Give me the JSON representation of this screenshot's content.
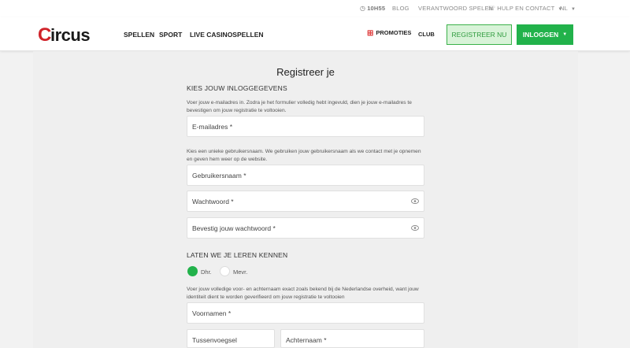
{
  "utility": {
    "time": "10H55",
    "blog": "BLOG",
    "responsible": "VERANTWOORD SPELEN",
    "help": "HULP EN CONTACT",
    "language": "NL"
  },
  "header": {
    "logo_text": "Circus",
    "nav": [
      "SPELLEN",
      "SPORT",
      "LIVE CASINOSPELLEN"
    ],
    "promotions": "PROMOTIES",
    "club": "CLUB",
    "register": "REGISTREER NU",
    "login": "INLOGGEN"
  },
  "form": {
    "title": "Registreer je",
    "section_login": "KIES JOUW INLOGGEGEVENS",
    "email_help_1": "Voer jouw e-mailadres in. Zodra je het formulier volledig hebt ingevuld, dien je jouw e-mailadres te",
    "email_help_2": "bevestigen om jouw registratie te voltooien.",
    "email_placeholder": "E-mailadres *",
    "username_help_1": "Kies een unieke gebruikersnaam. We gebruiken jouw gebruikersnaam als we contact met je opnemen",
    "username_help_2": "en geven hem weer op de website.",
    "username_placeholder": "Gebruikersnaam *",
    "password_placeholder": "Wachtwoord *",
    "confirm_placeholder": "Bevestig jouw wachtwoord *",
    "section_about": "LATEN WE JE LEREN KENNEN",
    "gender_male": "Dhr.",
    "gender_female": "Mevr.",
    "gender_selected": "Dhr.",
    "name_help_1": "Voer jouw volledige voor- en achternaam exact zoals bekend bij de Nederlandse overheid, want jouw",
    "name_help_2": "identiteit dient te worden geverifieerd om jouw registratie te voltooien",
    "firstname_placeholder": "Voornamen *",
    "middlename_placeholder": "Tussenvoegsel",
    "lastname_placeholder": "Achternaam *"
  },
  "colors": {
    "brand_red": "#d0232a",
    "accent_green": "#22b24b",
    "register_bg": "#d8f3d8"
  }
}
